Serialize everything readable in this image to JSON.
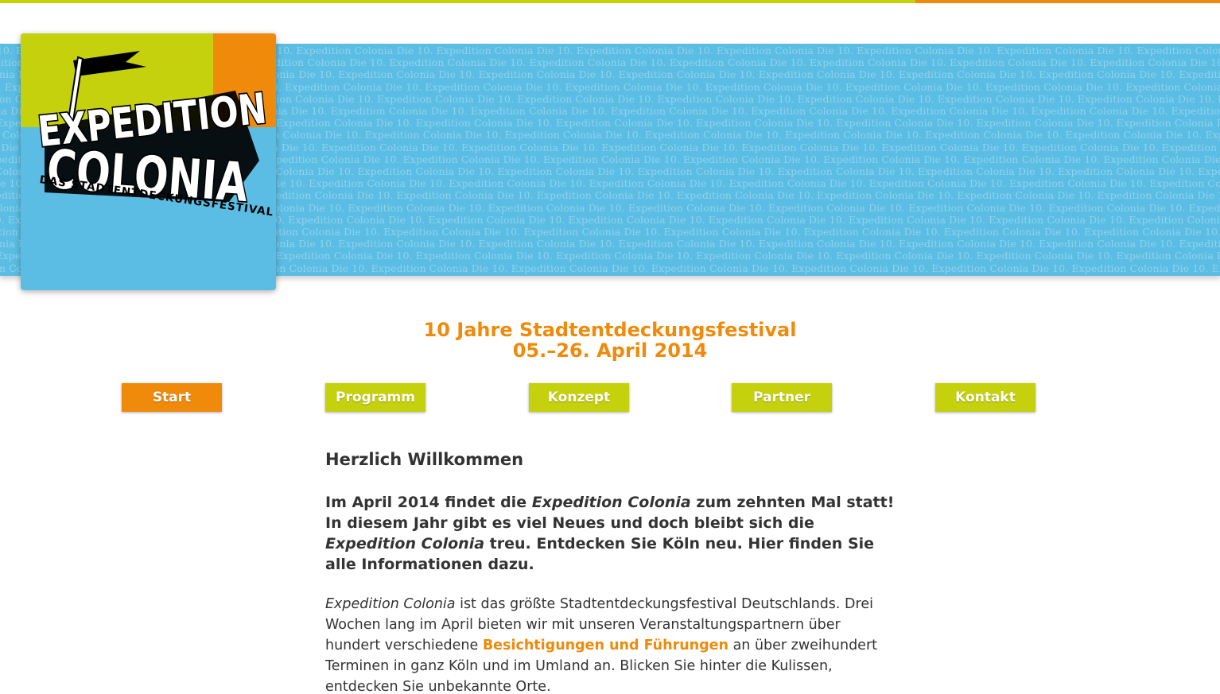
{
  "colors": {
    "accent_green": "#c5d10d",
    "accent_orange": "#ef8a0a",
    "banner_blue": "#5bbde3",
    "banner_pattern": "#8fd2ee",
    "body_text": "#333333"
  },
  "banner": {
    "pattern_text": "Die 10. Expedition Colonia"
  },
  "logo": {
    "line1": "EXPEDITION",
    "line2": "COLONIA",
    "tagline": "DAS STADTENTDECKUNGSFESTIVAL"
  },
  "headline": {
    "line1": "10 Jahre Stadtentdeckungsfestival",
    "line2": "05.–26. April 2014"
  },
  "nav": {
    "items": [
      {
        "label": "Start",
        "active": true
      },
      {
        "label": "Programm",
        "active": false
      },
      {
        "label": "Konzept",
        "active": false
      },
      {
        "label": "Partner",
        "active": false
      },
      {
        "label": "Kontakt",
        "active": false
      }
    ]
  },
  "content": {
    "title": "Herzlich Willkommen",
    "lead": {
      "part1": "Im April 2014 findet die ",
      "em1": "Expedition Colonia",
      "part2": " zum zehnten Mal statt! In diesem Jahr gibt es viel Neues und doch bleibt sich die ",
      "em2": "Expedition Colonia",
      "part3": " treu. Entdecken Sie Köln neu. Hier finden Sie alle Informationen dazu."
    },
    "body": {
      "em": "Expedition Colonia",
      "part1": " ist das größte Stadtentdeckungsfestival Deutschlands. Drei Wochen lang im April bieten wir mit unseren Veranstaltungspartnern über hundert verschiedene ",
      "link": "Besichtigungen und Führungen",
      "part2": " an über zweihundert Terminen in ganz Köln und im Umland an. Blicken Sie hinter die Kulissen, entdecken Sie unbekannte Orte."
    }
  }
}
